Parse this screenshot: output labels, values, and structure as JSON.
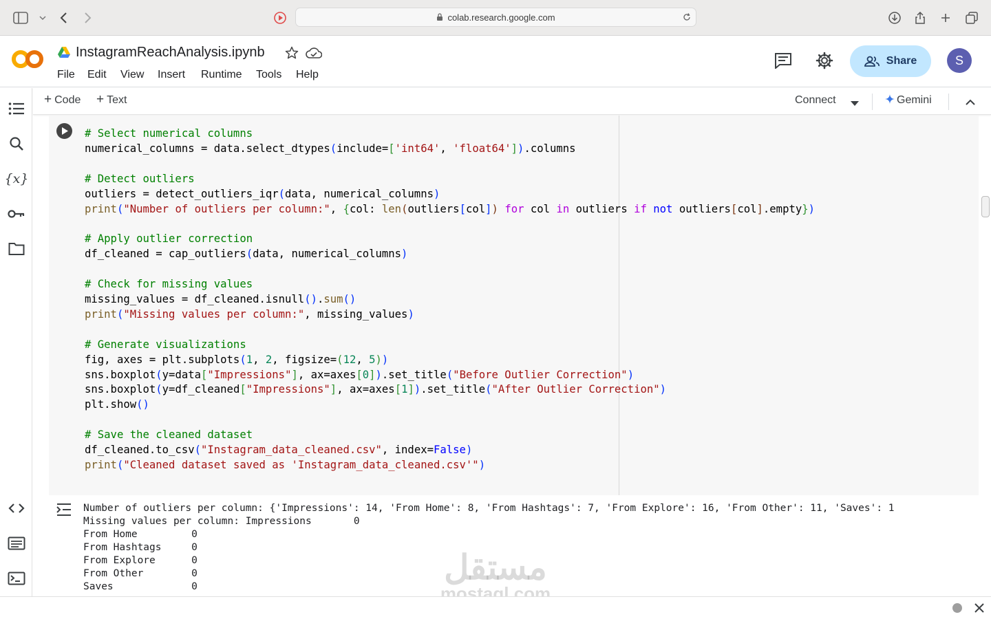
{
  "browser": {
    "url": "colab.research.google.com"
  },
  "header": {
    "notebook_title": "InstagramReachAnalysis.ipynb",
    "menu": [
      "File",
      "Edit",
      "View",
      "Insert",
      "Runtime",
      "Tools",
      "Help"
    ],
    "share_label": "Share",
    "avatar_letter": "S"
  },
  "toolbar": {
    "add_code_label": "Code",
    "add_text_label": "Text",
    "connect_label": "Connect",
    "gemini_label": "Gemini"
  },
  "colors": {
    "brand_orange": "#f9ab00",
    "share_bg": "#c2e7ff",
    "avatar_bg": "#5c5fb0"
  },
  "icons": [
    "sidebar-icon",
    "chevron-down-icon",
    "back-icon",
    "forward-icon",
    "record-icon",
    "lock-icon",
    "reload-icon",
    "download-icon",
    "share-icon",
    "plus-icon",
    "tabs-icon",
    "colab-logo",
    "drive-icon",
    "star-icon",
    "cloud-icon",
    "comment-icon",
    "gear-icon",
    "people-icon",
    "toc-icon",
    "search-icon",
    "variables-icon",
    "key-icon",
    "folder-icon",
    "code-snippets-icon",
    "command-palette-icon",
    "terminal-icon",
    "run-icon",
    "output-icon",
    "gemini-icon",
    "collapse-icon",
    "dot-icon",
    "close-icon"
  ],
  "code": {
    "comment_select": "# Select numerical columns",
    "comment_detect": "# Detect outliers",
    "print_outliers_str": "\"Number of outliers per column:\"",
    "comment_apply": "# Apply outlier correction",
    "comment_missing": "# Check for missing values",
    "print_missing_str": "\"Missing values per column:\"",
    "comment_viz": "# Generate visualizations",
    "title_before": "\"Before Outlier Correction\"",
    "title_after": "\"After Outlier Correction\"",
    "comment_save": "# Save the cleaned dataset",
    "csv_name": "\"Instagram_data_cleaned.csv\"",
    "print_saved_str": "\"Cleaned dataset saved as 'Instagram_data_cleaned.csv'\""
  },
  "output": {
    "lines": [
      "Number of outliers per column: {'Impressions': 14, 'From Home': 8, 'From Hashtags': 7, 'From Explore': 16, 'From Other': 11, 'Saves': 1",
      "Missing values per column: Impressions       0",
      "From Home         0",
      "From Hashtags     0",
      "From Explore      0",
      "From Other        0",
      "Saves             0"
    ]
  },
  "watermark": {
    "arabic": "مستقل",
    "latin": "mostaql.com"
  }
}
